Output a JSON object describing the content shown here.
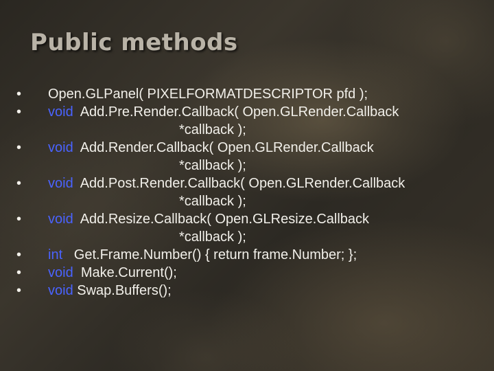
{
  "slide": {
    "title": "Public methods",
    "bullet_char": "•",
    "items": [
      {
        "keyword": "",
        "text": "Open.GLPanel( PIXELFORMATDESCRIPTOR pfd );",
        "continuation": ""
      },
      {
        "keyword": "void",
        "text": "  Add.Pre.Render.Callback( Open.GLRender.Callback",
        "continuation": "*callback );"
      },
      {
        "keyword": "void",
        "text": "  Add.Render.Callback( Open.GLRender.Callback",
        "continuation": "*callback );"
      },
      {
        "keyword": "void",
        "text": "  Add.Post.Render.Callback( Open.GLRender.Callback",
        "continuation": "*callback );"
      },
      {
        "keyword": "void",
        "text": "  Add.Resize.Callback( Open.GLResize.Callback",
        "continuation": "*callback );"
      },
      {
        "keyword": "int",
        "text": "   Get.Frame.Number() { return frame.Number; };",
        "continuation": ""
      },
      {
        "keyword": "void",
        "text": "  Make.Current();",
        "continuation": ""
      },
      {
        "keyword": "void",
        "text": " Swap.Buffers();",
        "continuation": ""
      }
    ]
  },
  "colors": {
    "title": "#b9b3a7",
    "text": "#f2f0ea",
    "keyword": "#4a63ff",
    "background": "#2f2b25"
  }
}
